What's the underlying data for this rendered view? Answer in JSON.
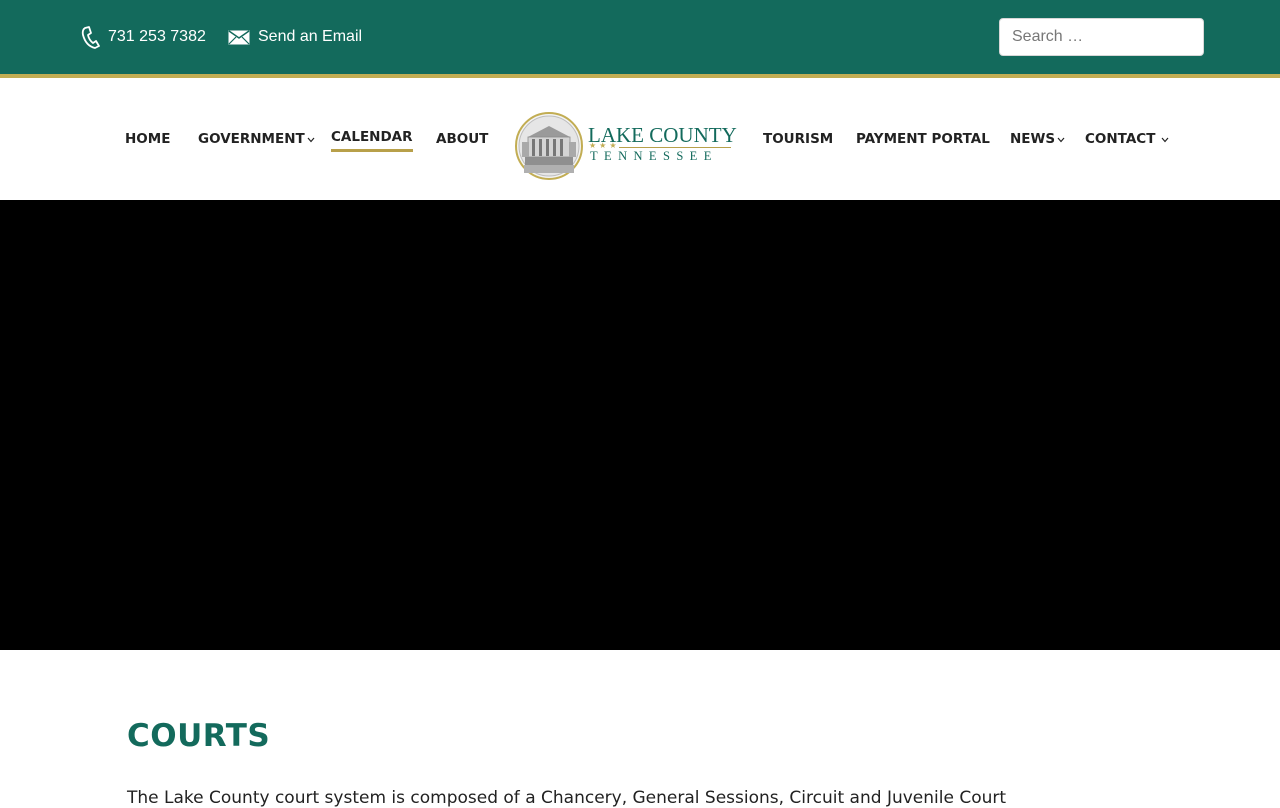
{
  "topbar": {
    "phone": "731 253 7382",
    "email_label": "Send an Email",
    "search_placeholder": "Search …",
    "background": "#136a5c",
    "accent": "#c2ad53"
  },
  "nav": {
    "items": [
      {
        "label": "HOME"
      },
      {
        "label": "GOVERNMENT"
      },
      {
        "label": "CALENDAR"
      },
      {
        "label": "ABOUT"
      },
      {
        "label": "TOURISM"
      },
      {
        "label": "PAYMENT PORTAL"
      },
      {
        "label": "NEWS"
      },
      {
        "label": "CONTACT"
      }
    ],
    "active": "CALENDAR"
  },
  "logo": {
    "title": "LAKE COUNTY",
    "subtitle": "TENNESSEE"
  },
  "main": {
    "title": "COURTS",
    "intro": "The Lake County court system is composed of a Chancery, General Sessions, Circuit and Juvenile Court"
  }
}
